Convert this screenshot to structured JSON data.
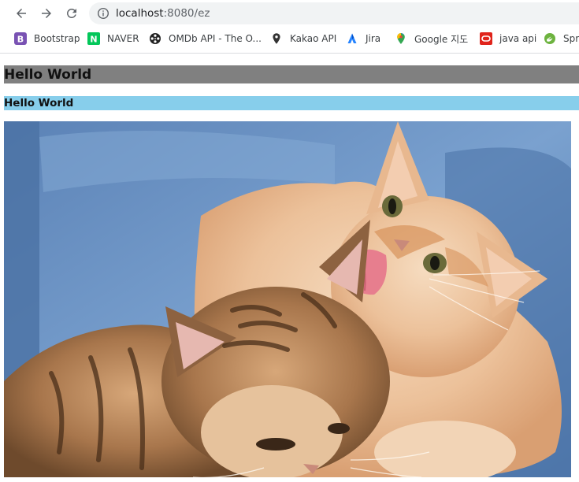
{
  "browser": {
    "url_host": "localhost",
    "url_rest": ":8080/ez",
    "bookmarks": [
      {
        "label": "Bootstrap",
        "icon": "bootstrap-icon",
        "color": "#7952b3"
      },
      {
        "label": "NAVER",
        "icon": "naver-icon",
        "color": "#03c75a"
      },
      {
        "label": "OMDb API - The O...",
        "icon": "film-reel-icon",
        "color": "#222222"
      },
      {
        "label": "Kakao API",
        "icon": "map-pin-icon",
        "color": "#333333"
      },
      {
        "label": "Jira",
        "icon": "jira-icon",
        "color": "#2684ff"
      },
      {
        "label": "Google 지도",
        "icon": "google-maps-icon",
        "color": "#34a853"
      },
      {
        "label": "java api",
        "icon": "oracle-icon",
        "color": "#e0241b"
      },
      {
        "label": "Spr",
        "icon": "spring-icon",
        "color": "#6db33f"
      }
    ]
  },
  "page": {
    "heading1": "Hello World",
    "heading2": "Hello World",
    "heading1_bg": "#808080",
    "heading2_bg": "#87ceeb",
    "image_subject": "two kittens on a blue sofa, one licking the other's head"
  }
}
